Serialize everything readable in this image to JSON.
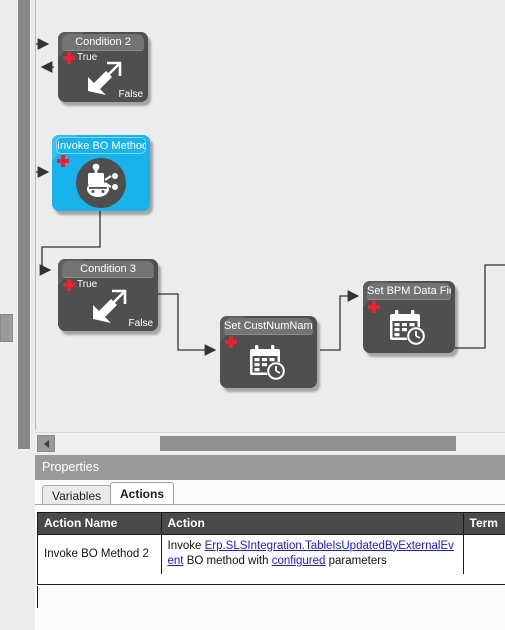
{
  "canvas": {
    "nodes": [
      {
        "id": "condition-2",
        "title": "Condition 2",
        "true_label": "True",
        "false_label": "False",
        "icon": "condition-arrows-icon",
        "accent": false
      },
      {
        "id": "invoke-bo-method",
        "title": "Invoke BO Method",
        "icon": "invoke-bo-method-icon",
        "accent": true,
        "accent_color": "#18b2ec"
      },
      {
        "id": "condition-3",
        "title": "Condition 3",
        "true_label": "True",
        "false_label": "False",
        "icon": "condition-arrows-icon",
        "accent": false
      },
      {
        "id": "set-custnumname",
        "title": "Set CustNumName",
        "icon": "set-field-calendar-icon",
        "accent": false
      },
      {
        "id": "set-bpm-data-field",
        "title": "Set BPM Data Field",
        "icon": "set-field-calendar-icon",
        "accent": false
      }
    ]
  },
  "scrollbar": {
    "left_arrow_icon": "arrow-left-icon"
  },
  "properties": {
    "title": "Properties",
    "tabs": [
      {
        "label": "Variables",
        "active": false
      },
      {
        "label": "Actions",
        "active": true
      }
    ],
    "grid": {
      "columns": [
        "Action Name",
        "Action",
        "Term"
      ],
      "rows": [
        {
          "action_name": "Invoke BO Method 2",
          "action_prefix": "Invoke ",
          "action_link": "Erp.SLSIntegration.TableIsUpdatedByExternalEvent",
          "action_middle": " BO method with ",
          "action_link2": "configured",
          "action_suffix": " parameters",
          "term": ""
        }
      ]
    }
  },
  "colors": {
    "canvas_bg": "#ececed",
    "node_body": "#4f4f4f",
    "node_title": "#737373",
    "accent": "#18b2ec",
    "plus_red": "#e8212b",
    "link_blue": "#1a1ae0",
    "header_gray": "#9a9a9a",
    "grid_header": "#4a4a4a"
  }
}
